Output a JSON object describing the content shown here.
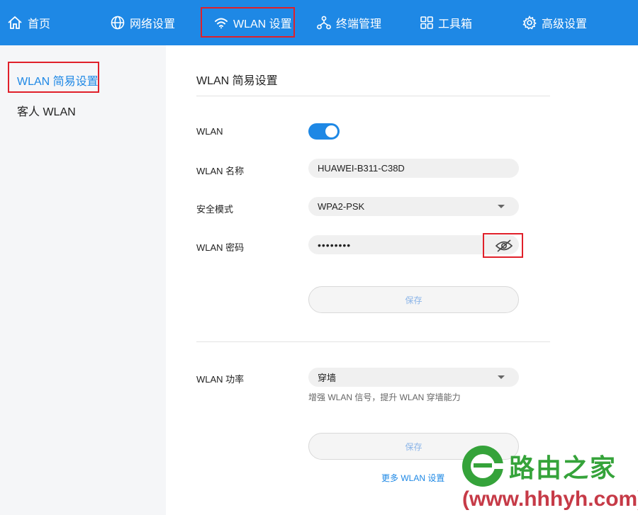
{
  "nav": {
    "home": "首页",
    "network": "网络设置",
    "wlan": "WLAN 设置",
    "terminal": "终端管理",
    "tools": "工具箱",
    "advanced": "高级设置"
  },
  "sidebar": {
    "items": [
      {
        "label": "WLAN 简易设置",
        "active": true
      },
      {
        "label": "客人 WLAN",
        "active": false
      }
    ]
  },
  "main": {
    "title": "WLAN 简易设置",
    "wlan_label": "WLAN",
    "wlan_enabled": true,
    "ssid_label": "WLAN 名称",
    "ssid_value": "HUAWEI-B311-C38D",
    "security_label": "安全模式",
    "security_value": "WPA2-PSK",
    "password_label": "WLAN 密码",
    "password_value": "••••••••",
    "save_label": "保存",
    "power_label": "WLAN 功率",
    "power_value": "穿墙",
    "power_hint": "增强 WLAN 信号，提升 WLAN 穿墙能力",
    "save2_label": "保存",
    "more_link": "更多 WLAN 设置"
  },
  "watermark": {
    "name": "路由之家",
    "url": "(www.hhhyh.com)"
  },
  "colors": {
    "accent": "#1e88e5",
    "highlight": "#e0202a",
    "watermark_green": "#35a33a",
    "watermark_red": "#c63a47"
  }
}
